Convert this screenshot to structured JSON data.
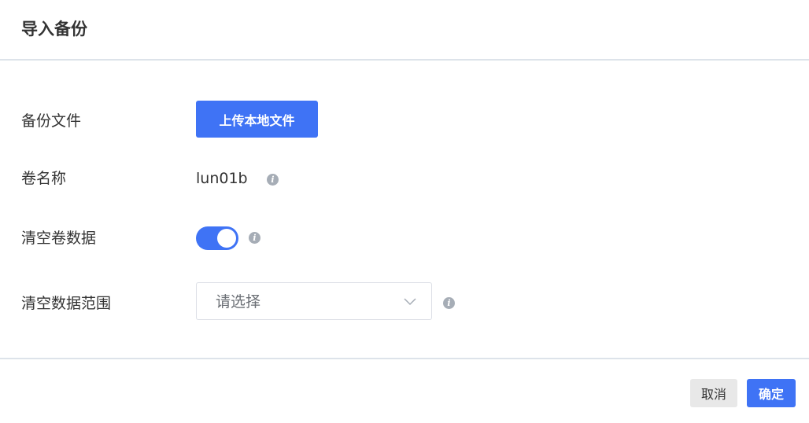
{
  "dialog": {
    "title": "导入备份"
  },
  "form": {
    "backup_file": {
      "label": "备份文件",
      "upload_button": "上传本地文件"
    },
    "volume_name": {
      "label": "卷名称",
      "value": "lun01b",
      "info_icon": "info-icon"
    },
    "clear_volume_data": {
      "label": "清空卷数据",
      "enabled": true,
      "info_icon": "info-icon"
    },
    "clear_data_range": {
      "label": "清空数据范围",
      "placeholder": "请选择",
      "dropdown_icon": "chevron-down-icon",
      "info_icon": "info-icon"
    }
  },
  "footer": {
    "cancel_label": "取消",
    "confirm_label": "确定"
  },
  "colors": {
    "primary": "#3f73f5",
    "divider": "#dde3ea",
    "info_icon": "#a6adb6",
    "cancel_bg": "#e8e8e8"
  }
}
